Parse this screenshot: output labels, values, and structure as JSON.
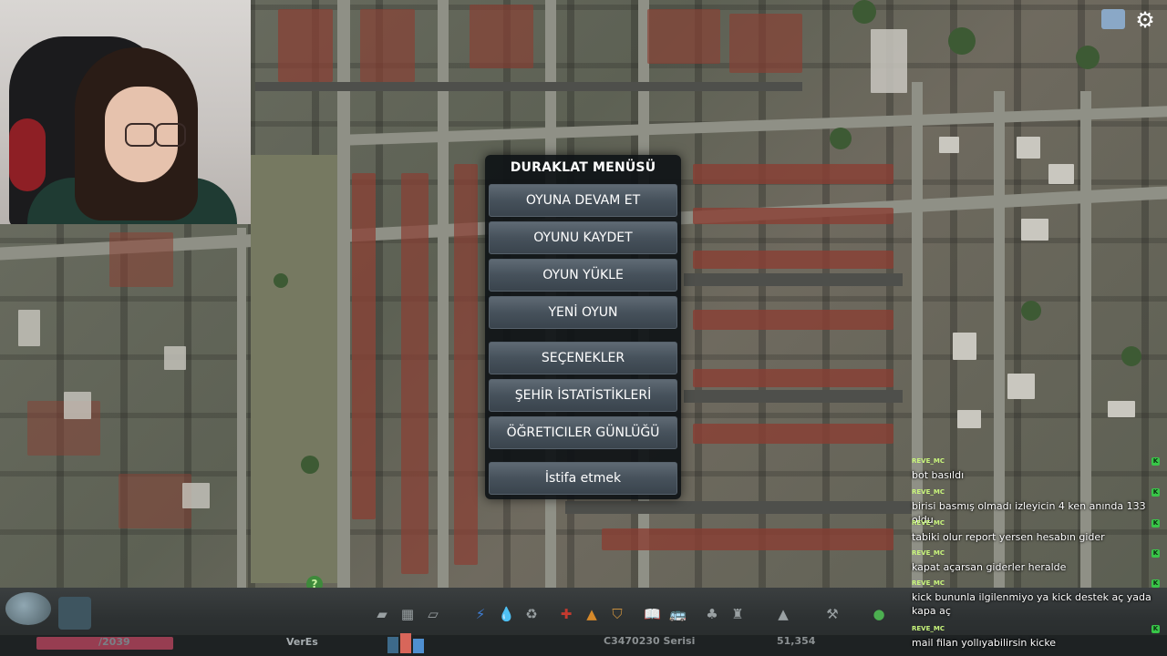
{
  "pause_menu": {
    "title": "DURAKLAT MENÜSÜ",
    "buttons": [
      {
        "label": "OYUNA DEVAM ET"
      },
      {
        "label": "OYUNU KAYDET"
      },
      {
        "label": "OYUN YÜKLE"
      },
      {
        "label": "YENİ OYUN"
      },
      {
        "label": "SEÇENEKLER"
      },
      {
        "label": "ŞEHİR İSTATİSTİKLERİ"
      },
      {
        "label": "ÖĞRETICILER GÜNLÜĞÜ"
      },
      {
        "label": "İstifa etmek"
      }
    ]
  },
  "toolbar": {
    "date": "/2039",
    "city_name": "VerEs",
    "money": "C3470230 Serisi",
    "population": "51,354"
  },
  "chat": {
    "messages": [
      {
        "user": "REVE_MC",
        "badge": "K",
        "text": "bot basıldı"
      },
      {
        "user": "REVE_MC",
        "badge": "K",
        "text": "birisi basmış olmadı izleyicin 4 ken anında 133 oldu"
      },
      {
        "user": "REVE_MC",
        "badge": "K",
        "text": "tabiki olur report yersen hesabın gider"
      },
      {
        "user": "REVE_MC",
        "badge": "K",
        "text": "kapat açarsan giderler heralde"
      },
      {
        "user": "REVE_MC",
        "badge": "K",
        "text": "kick bununla ilgilenmiyo ya kick destek aç yada kapa aç"
      },
      {
        "user": "REVE_MC",
        "badge": "K",
        "text": "mail filan yollıyabilirsin kicke"
      }
    ]
  },
  "icons": {
    "settings": "gear-icon",
    "screenshot": "photo-icon",
    "help": "question-icon"
  },
  "help_label": "?"
}
